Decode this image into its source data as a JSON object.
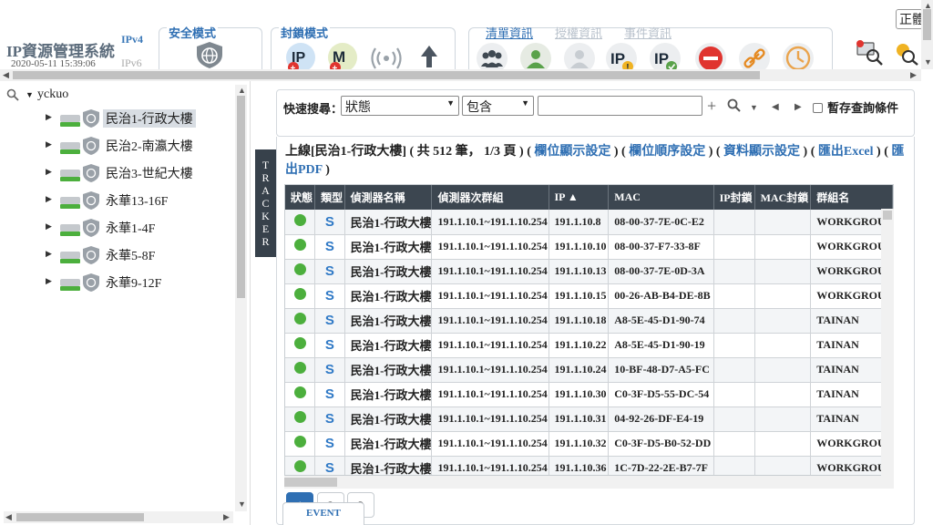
{
  "app": {
    "title": "IP資源管理系統",
    "datetime": "2020-05-11 15:39:06",
    "ipv4_label": "IPv4",
    "ipv6_label": "IPv6",
    "lang_button": "正體"
  },
  "toolbar": {
    "safe_mode_label": "安全模式",
    "block_mode_label": "封鎖模式",
    "tabs": {
      "list": "清單資訊",
      "auth": "授權資訊",
      "event": "事件資訊"
    }
  },
  "tree": {
    "root": "yckuo",
    "nodes": [
      {
        "label": "民治1-行政大樓",
        "selected": true
      },
      {
        "label": "民治2-南瀛大樓",
        "selected": false
      },
      {
        "label": "民治3-世紀大樓",
        "selected": false
      },
      {
        "label": "永華13-16F",
        "selected": false
      },
      {
        "label": "永華1-4F",
        "selected": false
      },
      {
        "label": "永華5-8F",
        "selected": false
      },
      {
        "label": "永華9-12F",
        "selected": false
      }
    ]
  },
  "tracker": [
    "T",
    "R",
    "A",
    "C",
    "K",
    "E",
    "R"
  ],
  "search": {
    "label": "快速搜尋：",
    "field": "狀態",
    "operator": "包含",
    "value": "",
    "save_query_label": "暫存查詢條件"
  },
  "summary": {
    "prefix": "上線[民治1-行政大樓]",
    "counts": " ( 共 512 筆， 1/3 頁 ) ( ",
    "link_columns": "欄位顯示設定",
    "sep1": " ) ( ",
    "link_order": "欄位順序設定",
    "sep2": " ) ( ",
    "link_data": "資料顯示設定",
    "sep3": " ) ( ",
    "link_excel": "匯出Excel",
    "sep4": " ) ( ",
    "link_pdf": "匯出PDF",
    "suffix": " )"
  },
  "table": {
    "headers": [
      "狀態",
      "類型",
      "偵測器名稱",
      "偵測器次群組",
      "IP ▲",
      "MAC",
      "IP封鎖",
      "MAC封鎖",
      "群組名"
    ],
    "rows": [
      {
        "type": "S",
        "name": "民治1-行政大樓",
        "subgroup": "191.1.10.1~191.1.10.254",
        "ip": "191.1.10.8",
        "mac": "08-00-37-7E-0C-E2",
        "group": "WORKGROUP"
      },
      {
        "type": "S",
        "name": "民治1-行政大樓",
        "subgroup": "191.1.10.1~191.1.10.254",
        "ip": "191.1.10.10",
        "mac": "08-00-37-F7-33-8F",
        "group": "WORKGROUP"
      },
      {
        "type": "S",
        "name": "民治1-行政大樓",
        "subgroup": "191.1.10.1~191.1.10.254",
        "ip": "191.1.10.13",
        "mac": "08-00-37-7E-0D-3A",
        "group": "WORKGROUP"
      },
      {
        "type": "S",
        "name": "民治1-行政大樓",
        "subgroup": "191.1.10.1~191.1.10.254",
        "ip": "191.1.10.15",
        "mac": "00-26-AB-B4-DE-8B",
        "group": "WORKGROUP"
      },
      {
        "type": "S",
        "name": "民治1-行政大樓",
        "subgroup": "191.1.10.1~191.1.10.254",
        "ip": "191.1.10.18",
        "mac": "A8-5E-45-D1-90-74",
        "group": "TAINAN"
      },
      {
        "type": "S",
        "name": "民治1-行政大樓",
        "subgroup": "191.1.10.1~191.1.10.254",
        "ip": "191.1.10.22",
        "mac": "A8-5E-45-D1-90-19",
        "group": "TAINAN"
      },
      {
        "type": "S",
        "name": "民治1-行政大樓",
        "subgroup": "191.1.10.1~191.1.10.254",
        "ip": "191.1.10.24",
        "mac": "10-BF-48-D7-A5-FC",
        "group": "TAINAN"
      },
      {
        "type": "S",
        "name": "民治1-行政大樓",
        "subgroup": "191.1.10.1~191.1.10.254",
        "ip": "191.1.10.30",
        "mac": "C0-3F-D5-55-DC-54",
        "group": "TAINAN"
      },
      {
        "type": "S",
        "name": "民治1-行政大樓",
        "subgroup": "191.1.10.1~191.1.10.254",
        "ip": "191.1.10.31",
        "mac": "04-92-26-DF-E4-19",
        "group": "TAINAN"
      },
      {
        "type": "S",
        "name": "民治1-行政大樓",
        "subgroup": "191.1.10.1~191.1.10.254",
        "ip": "191.1.10.32",
        "mac": "C0-3F-D5-B0-52-DD",
        "group": "WORKGROUP"
      },
      {
        "type": "S",
        "name": "民治1-行政大樓",
        "subgroup": "191.1.10.1~191.1.10.254",
        "ip": "191.1.10.36",
        "mac": "1C-7D-22-2E-B7-7F",
        "group": "WORKGROUP"
      }
    ]
  },
  "pager": {
    "pages": [
      "1",
      "2",
      "3"
    ],
    "current": "1"
  },
  "event_tab": "EVENT",
  "colors": {
    "accent": "#2f6fb3",
    "header": "#3c4650",
    "online": "#4caf3d",
    "block": "#e0342f"
  }
}
